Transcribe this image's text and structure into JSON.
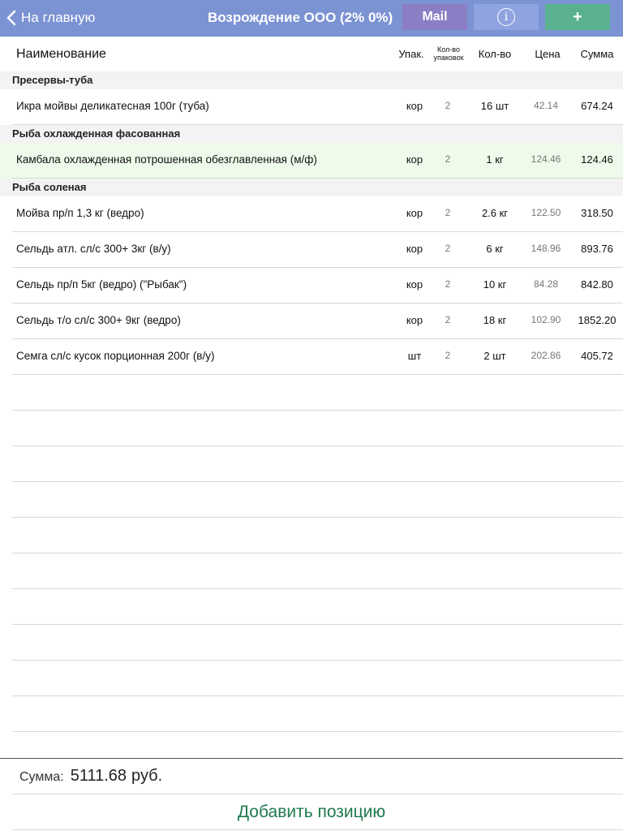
{
  "navbar": {
    "back_label": "На главную",
    "title": "Возрождение ООО (2% 0%)",
    "mail_label": "Mail",
    "info_label": "i",
    "add_label": "+"
  },
  "columns": {
    "name": "Наименование",
    "unit": "Упак.",
    "packs_line1": "Кол-во",
    "packs_line2": "упаковок",
    "qty": "Кол-во",
    "price": "Цена",
    "sum": "Сумма"
  },
  "sections": [
    {
      "title": "Пресервы-туба",
      "rows": [
        {
          "name": "Икра мойвы деликатесная 100г (туба)",
          "unit": "кор",
          "packs": "2",
          "qty": "16 шт",
          "price": "42.14",
          "sum": "674.24"
        }
      ]
    },
    {
      "title": "Рыба охлажденная фасованная",
      "rows": [
        {
          "name": "Камбала охлажденная потрошенная обезглавленная (м/ф)",
          "unit": "кор",
          "packs": "2",
          "qty": "1 кг",
          "price": "124.46",
          "sum": "124.46",
          "highlight": true
        }
      ]
    },
    {
      "title": "Рыба соленая",
      "rows": [
        {
          "name": "Мойва пр/п 1,3 кг (ведро)",
          "unit": "кор",
          "packs": "2",
          "qty": "2.6 кг",
          "price": "122.50",
          "sum": "318.50"
        },
        {
          "name": "Сельдь атл. сл/с 300+ 3кг (в/у)",
          "unit": "кор",
          "packs": "2",
          "qty": "6 кг",
          "price": "148.96",
          "sum": "893.76"
        },
        {
          "name": "Сельдь пр/п 5кг (ведро) (\"Рыбак\")",
          "unit": "кор",
          "packs": "2",
          "qty": "10 кг",
          "price": "84.28",
          "sum": "842.80"
        },
        {
          "name": "Сельдь т/о сл/с 300+ 9кг (ведро)",
          "unit": "кор",
          "packs": "2",
          "qty": "18 кг",
          "price": "102.90",
          "sum": "1852.20"
        },
        {
          "name": "Семга сл/с кусок порционная 200г (в/у)",
          "unit": "шт",
          "packs": "2",
          "qty": "2 шт",
          "price": "202.86",
          "sum": "405.72"
        }
      ]
    }
  ],
  "footer": {
    "total_label": "Сумма:",
    "total_value": "5111.68",
    "currency": "руб.",
    "add_position_label": "Добавить позицию"
  }
}
